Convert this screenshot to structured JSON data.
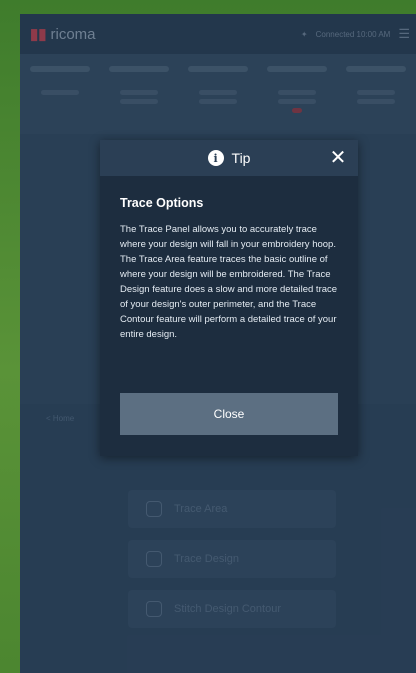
{
  "app": {
    "logo_text": "ricoma",
    "header_right_text": "Connected  10:00 AM"
  },
  "background": {
    "trace_buttons": [
      {
        "label": "Trace Area"
      },
      {
        "label": "Trace Design"
      },
      {
        "label": "Stitch Design Contour"
      }
    ],
    "back_label": "< Home"
  },
  "modal": {
    "header_title": "Tip",
    "section_title": "Trace Options",
    "body_text": "The Trace Panel allows you to accurately trace where your design will fall in your embroidery hoop. The Trace Area feature traces the basic outline of where your design will be embroidered. The Trace Design feature does a slow and more detailed trace of your design's outer perimeter, and the Trace Contour feature will perform a detailed trace of your entire design.",
    "close_button_label": "Close",
    "close_icon": "close-icon",
    "info_icon": "info-icon"
  }
}
